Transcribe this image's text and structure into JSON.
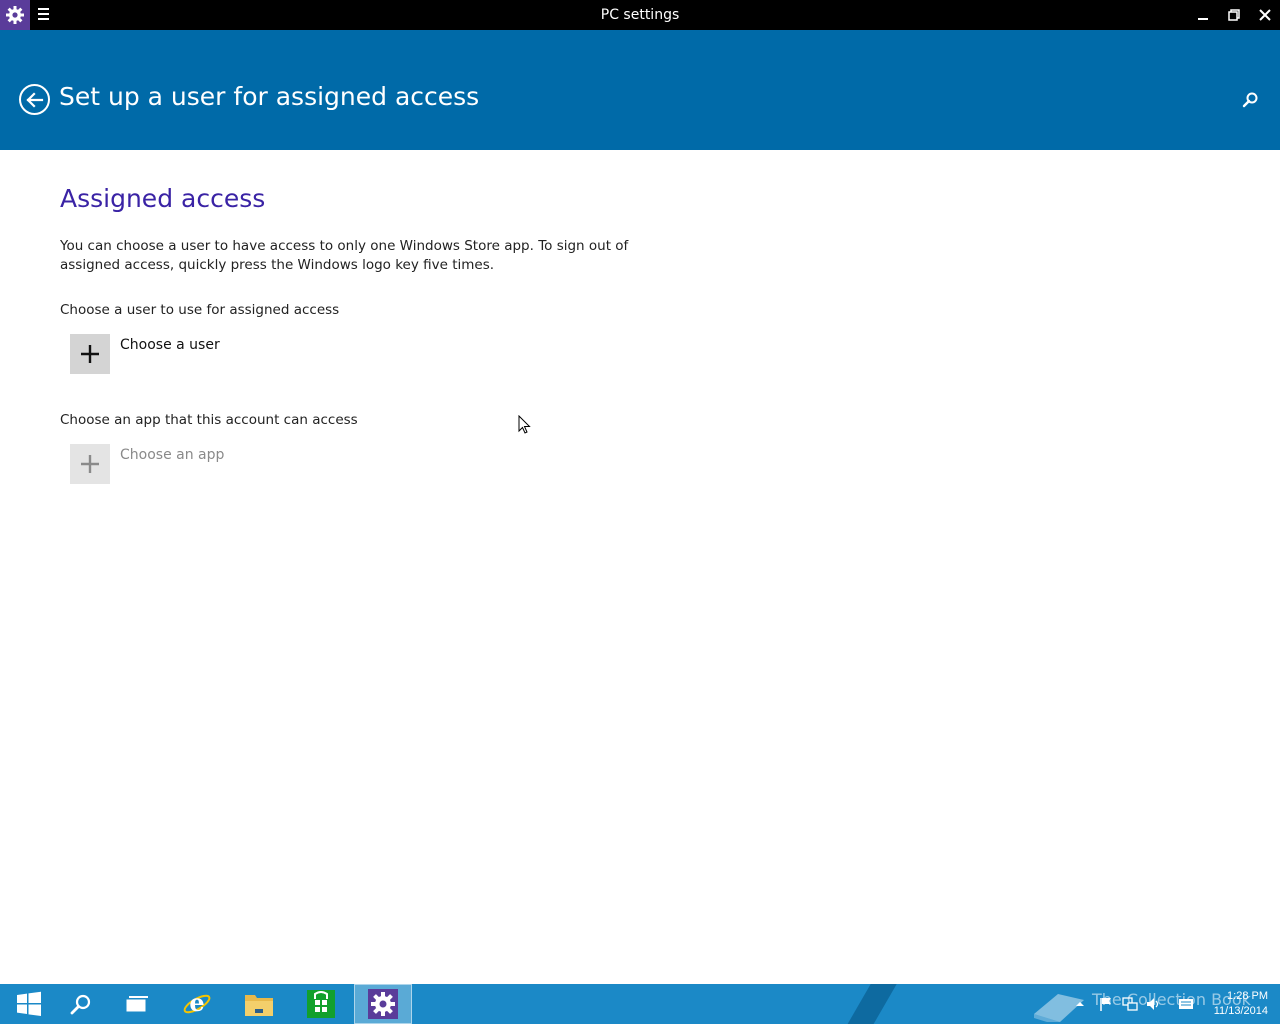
{
  "window": {
    "title": "PC settings"
  },
  "header": {
    "title": "Set up a user for assigned access"
  },
  "content": {
    "section_title": "Assigned access",
    "description": "You can choose a user to have access to only one Windows Store app. To sign out of assigned access, quickly press the Windows logo key five times.",
    "user_label": "Choose a user to use for assigned access",
    "user_button": "Choose a user",
    "app_label": "Choose an app that this account can access",
    "app_button": "Choose an app"
  },
  "taskbar": {
    "items": [
      "start-icon",
      "search-icon",
      "task-view-icon",
      "internet-explorer-icon",
      "file-explorer-icon",
      "store-icon",
      "settings-icon"
    ],
    "watermark": "The Collection Book",
    "clock_time": "1:28 PM",
    "clock_date": "11/13/2014"
  },
  "colors": {
    "titlebar": "#000000",
    "header": "#006aa8",
    "accent_text": "#3a23a5",
    "taskbar": "#1b89c7",
    "app_icon_bg": "#5a3c9a"
  }
}
